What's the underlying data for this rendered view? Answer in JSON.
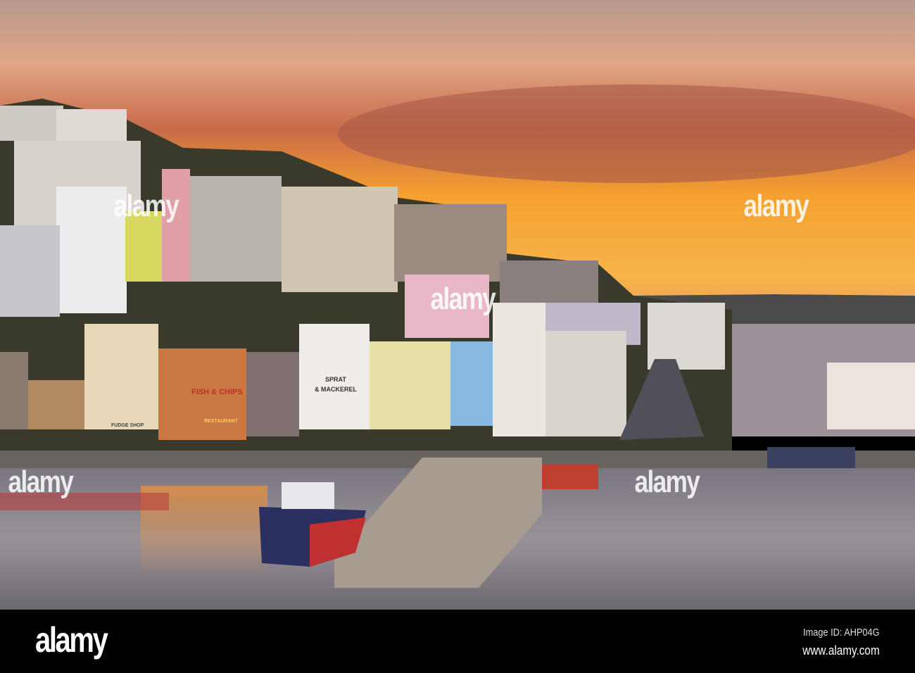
{
  "photo": {
    "signs": {
      "fish_chips": "FISH & CHIPS",
      "sprat": "SPRAT",
      "mackerel": "& MACKEREL",
      "fudge_shop": "FUDGE SHOP",
      "restaurant": "RESTAURANT"
    },
    "colors": {
      "sky_top": "#c9a08a",
      "sky_orange": "#f39a2c",
      "water": "#8c8790",
      "hill": "#3a3a2c"
    }
  },
  "watermark": {
    "text": "alamy"
  },
  "footer": {
    "logo": "alamy",
    "image_id": "Image ID: AHP04G",
    "url": "www.alamy.com"
  }
}
